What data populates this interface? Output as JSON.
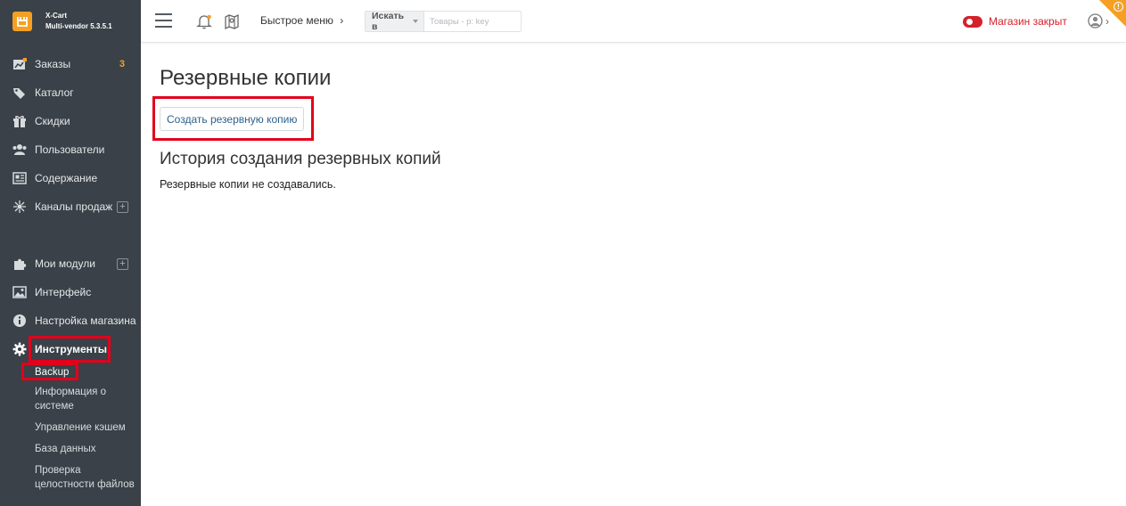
{
  "brand": {
    "name": "X-Cart",
    "version": "Multi-vendor 5.3.5.1",
    "logo_color": "#f5a023"
  },
  "sidebar": {
    "items": [
      {
        "label": "Заказы",
        "icon": "chart-icon",
        "badge": "3"
      },
      {
        "label": "Каталог",
        "icon": "tag-icon"
      },
      {
        "label": "Скидки",
        "icon": "gift-icon"
      },
      {
        "label": "Пользователи",
        "icon": "users-icon"
      },
      {
        "label": "Содержание",
        "icon": "content-icon"
      },
      {
        "label": "Каналы продаж",
        "icon": "network-icon",
        "plus": "+"
      }
    ],
    "items2": [
      {
        "label": "Мои модули",
        "icon": "puzzle-icon",
        "plus": "+"
      },
      {
        "label": "Интерфейс",
        "icon": "image-icon"
      },
      {
        "label": "Настройка магазина",
        "icon": "info-icon"
      },
      {
        "label": "Инструменты",
        "icon": "gear-icon"
      }
    ],
    "subitems": [
      "Backup",
      "Информация о системе",
      "Управление кэшем",
      "База данных",
      "Проверка целостности файлов"
    ]
  },
  "header": {
    "quick_menu": "Быстрое меню",
    "search_scope": "Искать в",
    "search_placeholder": "Товары - p: key",
    "store_status": "Магазин закрыт",
    "status_color": "#d4212b",
    "corner_mark": "!"
  },
  "main": {
    "title": "Резервные копии",
    "create_button": "Создать резервную копию",
    "history_title": "История создания резервных копий",
    "empty_text": "Резервные копии не создавались."
  },
  "highlight_color": "#e3001b"
}
